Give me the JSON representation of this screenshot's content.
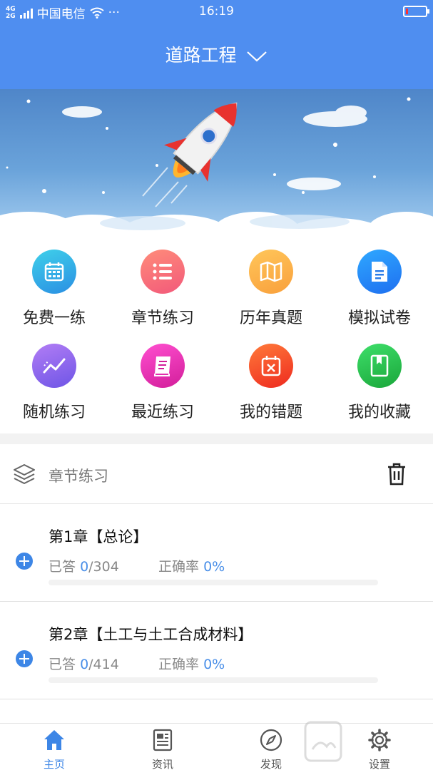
{
  "status_bar": {
    "network": "4G",
    "network2": "2G",
    "carrier": "中国电信",
    "dots": "···",
    "time": "16:19",
    "battery_level": 0.12
  },
  "header": {
    "title": "道路工程",
    "dropdown_icon": "chevron-down-icon"
  },
  "colors": {
    "brand": "#4f8ef0",
    "accent": "#3d86e6"
  },
  "grid": [
    {
      "label": "免费一练",
      "icon": "calendar-icon",
      "color1": "#3fd0ea",
      "color2": "#2a8fe3"
    },
    {
      "label": "章节练习",
      "icon": "list-icon",
      "color1": "#ff8c7a",
      "color2": "#f2597a"
    },
    {
      "label": "历年真题",
      "icon": "map-icon",
      "color1": "#ffc65a",
      "color2": "#f9a03c"
    },
    {
      "label": "模拟试卷",
      "icon": "document-icon",
      "color1": "#2fa8ff",
      "color2": "#1e6ff0"
    },
    {
      "label": "随机练习",
      "icon": "trend-icon",
      "color1": "#b27df5",
      "color2": "#6e55e6"
    },
    {
      "label": "最近练习",
      "icon": "book-icon",
      "color1": "#ff4fd0",
      "color2": "#d21e9a"
    },
    {
      "label": "我的错题",
      "icon": "wrong-calendar-icon",
      "color1": "#ff7a3a",
      "color2": "#ee2a1f"
    },
    {
      "label": "我的收藏",
      "icon": "bookmark-icon",
      "color1": "#3edf6a",
      "color2": "#1aa63a"
    }
  ],
  "section": {
    "title": "章节练习",
    "layers_icon": "layers-icon",
    "delete_icon": "trash-icon"
  },
  "chapters": [
    {
      "title": "第1章【总论】",
      "answered_label": "已答",
      "answered": "0",
      "total": "/304",
      "accuracy_label": "正确率",
      "accuracy": "0%",
      "progress": 0
    },
    {
      "title": "第2章【土工与土工合成材料】",
      "answered_label": "已答",
      "answered": "0",
      "total": "/414",
      "accuracy_label": "正确率",
      "accuracy": "0%",
      "progress": 0
    }
  ],
  "nav": [
    {
      "label": "主页",
      "icon": "home-icon",
      "active": true
    },
    {
      "label": "资讯",
      "icon": "news-icon",
      "active": false
    },
    {
      "label": "发现",
      "icon": "compass-icon",
      "active": false
    },
    {
      "label": "设置",
      "icon": "gear-icon",
      "active": false
    }
  ]
}
